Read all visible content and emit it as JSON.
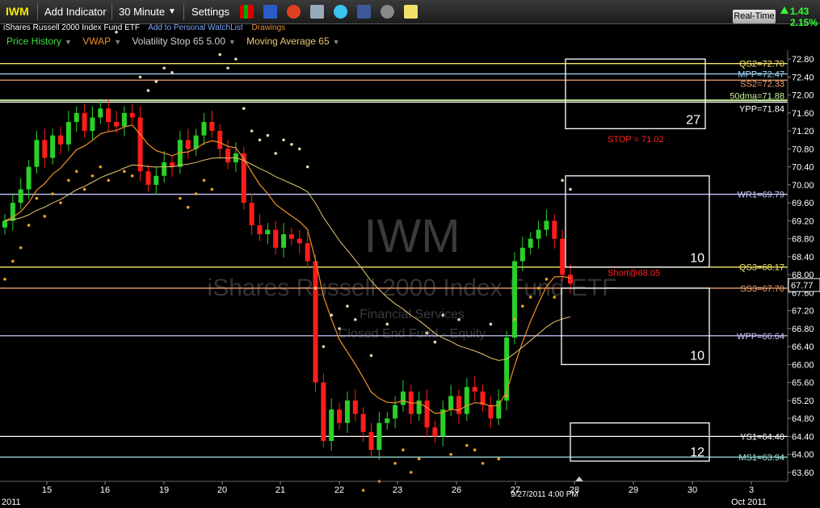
{
  "toolbar": {
    "symbol": "IWM",
    "add_indicator": "Add Indicator",
    "interval": "30 Minute",
    "settings": "Settings",
    "realtime": "Real-Time",
    "change": "1.43",
    "change_pct": "2.15%"
  },
  "header": {
    "fund_name": "iShares Russell 2000 Index Fund ETF",
    "watchlist_link": "Add to Personal WatchList",
    "drawings_link": "Drawings"
  },
  "indicators": [
    "Price History",
    "VWAP",
    "Volatility Stop 65 5.00",
    "Moving Average 65"
  ],
  "indicator_colors": [
    "#3cdc3c",
    "#f0902a",
    "#cfcfcf",
    "#e8c870"
  ],
  "watermark": {
    "symbol": "IWM",
    "name": "iShares Russell 2000 Index Fund ETF",
    "sector": "Financial Services",
    "category": "Closed End Fund - Equity"
  },
  "chart_data": {
    "type": "candlestick",
    "interval": "30 Minute",
    "ylim": [
      63.4,
      73.0
    ],
    "y_ticks": [
      63.6,
      64.0,
      64.4,
      64.8,
      65.2,
      65.6,
      66.0,
      66.4,
      66.8,
      67.2,
      67.6,
      68.0,
      68.4,
      68.8,
      69.2,
      69.6,
      70.0,
      70.4,
      70.8,
      71.2,
      71.6,
      72.0,
      72.4,
      72.8
    ],
    "x_tick_labels": [
      "15",
      "16",
      "19",
      "20",
      "21",
      "22",
      "23",
      "26",
      "27",
      "28",
      "29",
      "30",
      "3"
    ],
    "x_left_label": "2011",
    "x_right_label": "Oct 2011",
    "cursor_label": "9/27/2011 4:00 PM",
    "last_price": "67.77",
    "levels": [
      {
        "label": "QS2=72.70",
        "value": 72.7,
        "color": "#f5e86a"
      },
      {
        "label": "MPP=72.47",
        "value": 72.47,
        "color": "#9fd8ff"
      },
      {
        "label": "SS2=72.33",
        "value": 72.33,
        "color": "#f0a070"
      },
      {
        "label": "50dma=71.88",
        "value": 71.88,
        "color": "#c9f59b"
      },
      {
        "label": "YPP=71.84",
        "value": 71.84,
        "color": "#ffffff"
      },
      {
        "label": "WR1=69.79",
        "value": 69.79,
        "color": "#c8c8ff"
      },
      {
        "label": "QS3=68.17",
        "value": 68.17,
        "color": "#f5e86a"
      },
      {
        "label": "SS3=67.70",
        "value": 67.7,
        "color": "#f0a070"
      },
      {
        "label": "WPP=66.64",
        "value": 66.64,
        "color": "#c8c8ff"
      },
      {
        "label": "YS1=64.40",
        "value": 64.4,
        "color": "#ffffff"
      },
      {
        "label": "MS1=63.94",
        "value": 63.94,
        "color": "#9fe8e8"
      }
    ],
    "annotations": [
      {
        "text": "STOP = 71.02",
        "color": "#ff2020"
      },
      {
        "text": "Short@68.05",
        "color": "#ff2020"
      }
    ],
    "box_labels": [
      "27",
      "10",
      "10",
      "12"
    ],
    "closes": [
      69.2,
      69.6,
      69.9,
      70.4,
      71.0,
      70.6,
      71.1,
      70.9,
      71.4,
      71.6,
      71.2,
      71.5,
      71.7,
      71.4,
      71.3,
      71.6,
      71.5,
      70.3,
      70.0,
      70.2,
      70.5,
      70.4,
      71.0,
      70.8,
      71.1,
      71.4,
      71.2,
      70.8,
      70.5,
      70.7,
      69.6,
      69.1,
      68.9,
      69.0,
      68.6,
      68.9,
      68.8,
      68.7,
      68.3,
      65.6,
      64.3,
      65.0,
      64.7,
      65.2,
      64.9,
      64.5,
      64.1,
      64.7,
      64.8,
      65.1,
      65.4,
      64.9,
      65.2,
      64.6,
      64.4,
      65.0,
      65.3,
      64.9,
      65.5,
      65.4,
      65.1,
      64.8,
      65.2,
      66.6,
      68.3,
      68.6,
      68.8,
      69.0,
      69.2,
      68.8,
      68.0,
      67.8
    ]
  }
}
